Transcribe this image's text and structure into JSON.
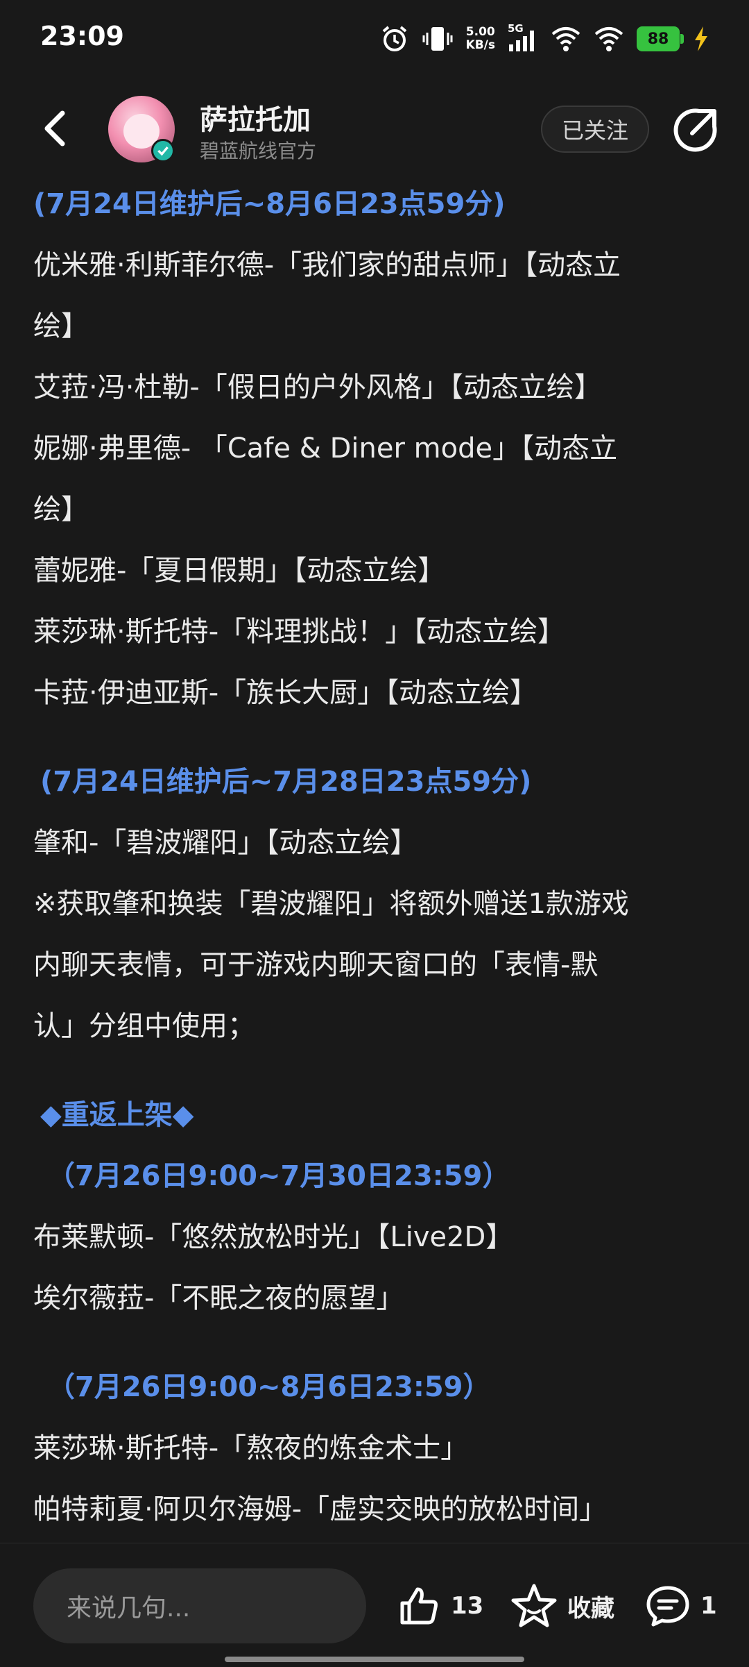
{
  "status_bar": {
    "time": "23:09",
    "net_speed_value": "5.00",
    "net_speed_unit": "KB/s",
    "network": "5G",
    "battery": "88",
    "icons": [
      "alarm-icon",
      "vibrate-icon",
      "signal-icon",
      "wifi-icon",
      "wifi-icon",
      "battery-icon",
      "charging-icon"
    ]
  },
  "header": {
    "author_name": "萨拉托加",
    "author_subtitle": "碧蓝航线官方",
    "follow_label": "已关注"
  },
  "article": {
    "lines": [
      "(7月24日维护后~8月6日23点59分)",
      "优米雅·利斯菲尔德-「我们家的甜点师」【动态立",
      "绘】",
      "艾菈·冯·杜勒-「假日的户外风格」【动态立绘】",
      "妮娜·弗里德- 「Cafe & Diner mode」【动态立",
      "绘】",
      "蕾妮雅-「夏日假期」【动态立绘】",
      "莱莎琳·斯托特-「料理挑战！」【动态立绘】",
      "卡菈·伊迪亚斯-「族长大厨」【动态立绘】",
      " (7月24日维护后~7月28日23点59分)",
      "肇和-「碧波耀阳」【动态立绘】",
      "※获取肇和换装「碧波耀阳」将额外赠送1款游戏",
      "内聊天表情，可于游戏内聊天窗口的「表情-默",
      "认」分组中使用；",
      " ◆重返上架◆",
      " （7月26日9:00~7月30日23:59）",
      "布莱默顿-「悠然放松时光」【Live2D】",
      "埃尔薇菈-「不眠之夜的愿望」",
      " （7月26日9:00~8月6日23:59）",
      "莱莎琳·斯托特-「熬夜的炼金术士」",
      "帕特莉夏·阿贝尔海姆-「虚实交映的放松时间」"
    ]
  },
  "bottom_bar": {
    "comment_placeholder": "来说几句...",
    "like_count": "13",
    "favorite_label": "收藏",
    "comment_count": "1"
  },
  "colors": {
    "background": "#191919",
    "highlight": "#5a8fea",
    "text": "#eaeaea",
    "battery": "#36c23f"
  }
}
